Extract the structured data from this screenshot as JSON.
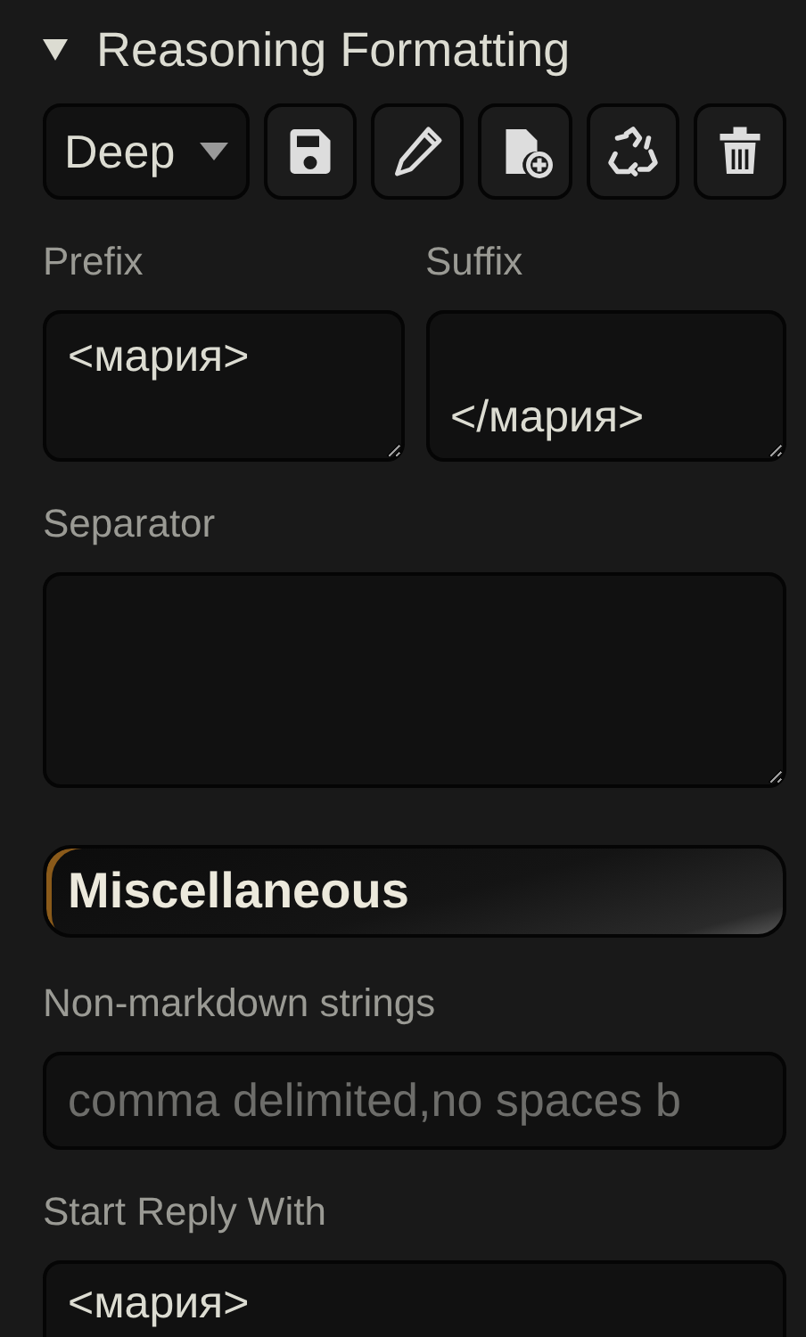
{
  "section": {
    "title": "Reasoning Formatting",
    "expanded": true
  },
  "toolbar": {
    "preset": "Deep",
    "buttons": [
      {
        "kind": "save"
      },
      {
        "kind": "rename"
      },
      {
        "kind": "new"
      },
      {
        "kind": "restore"
      },
      {
        "kind": "delete"
      }
    ]
  },
  "prefix": {
    "label": "Prefix",
    "value": "<мария>"
  },
  "suffix": {
    "label": "Suffix",
    "value": "\n</мария>"
  },
  "separator": {
    "label": "Separator"
  },
  "misc": {
    "title": "Miscellaneous"
  },
  "non_markdown": {
    "label": "Non-markdown strings",
    "placeholder": "comma delimited,no spaces b"
  },
  "start_reply": {
    "label": "Start Reply With",
    "value": "<мария>"
  }
}
